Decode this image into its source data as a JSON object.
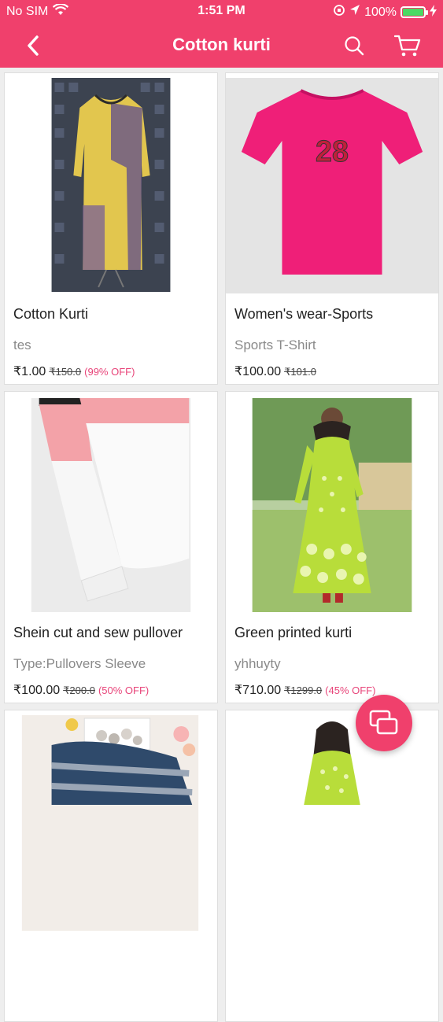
{
  "status_bar": {
    "carrier": "No SIM",
    "time": "1:51 PM",
    "battery": "100%"
  },
  "header": {
    "title": "Cotton kurti"
  },
  "products": [
    {
      "name": "Cotton Kurti",
      "subtitle": "tes",
      "price": "₹1.00",
      "mrp": "₹150.0",
      "discount": "(99% OFF)"
    },
    {
      "name": "Women's wear-Sports",
      "subtitle": "Sports T-Shirt",
      "price": "₹100.00",
      "mrp": "₹101.0",
      "discount": ""
    },
    {
      "name": "Shein cut and sew pullover",
      "subtitle": "Type:Pullovers Sleeve",
      "price": "₹100.00",
      "mrp": "₹200.0",
      "discount": "(50% OFF)"
    },
    {
      "name": "Green printed kurti",
      "subtitle": "yhhuyty",
      "price": "₹710.00",
      "mrp": "₹1299.0",
      "discount": "(45% OFF)"
    },
    {
      "name": "",
      "subtitle": "",
      "price": "",
      "mrp": "",
      "discount": ""
    },
    {
      "name": "",
      "subtitle": "",
      "price": "",
      "mrp": "",
      "discount": ""
    }
  ],
  "colors": {
    "brand": "#f0406c",
    "discount": "#e8457a"
  },
  "icons": {
    "back": "chevron-left-icon",
    "search": "search-icon",
    "cart": "cart-icon",
    "fab": "chat-bubbles-icon"
  }
}
